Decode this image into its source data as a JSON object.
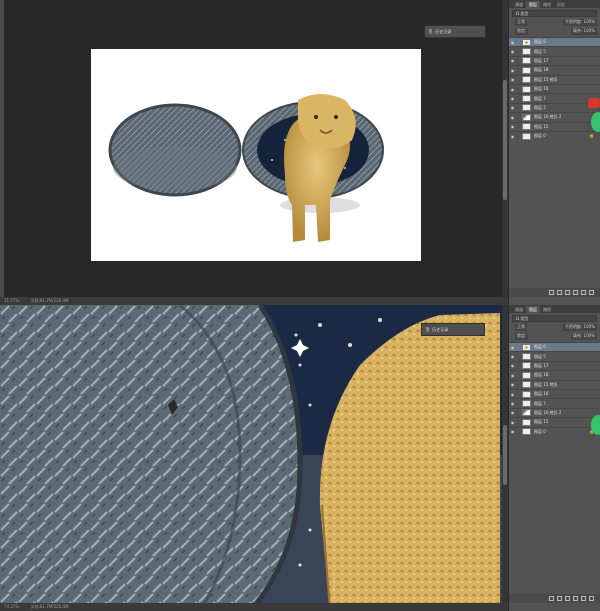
{
  "app": "Photoshop",
  "top_window": {
    "status": {
      "zoom": "11.57%",
      "doc_size": "文档:81.7M/226.4M"
    },
    "history_panel": {
      "label": "历史记录"
    },
    "layers_panel": {
      "tabs": [
        "通道",
        "图层",
        "路径",
        "历史"
      ],
      "filter_label": "Ω 类型",
      "blend_mode": "正常",
      "opacity": "不透明度: 100%",
      "lock_label": "锁定:",
      "fill": "填充: 100%",
      "layers": [
        {
          "name": "图层 6",
          "thumb": "tiger"
        },
        {
          "name": "图层 5",
          "thumb": "plain"
        },
        {
          "name": "图层 17",
          "thumb": "plain"
        },
        {
          "name": "图层 18",
          "thumb": "plain"
        },
        {
          "name": "图层 15 拷贝",
          "thumb": "plain"
        },
        {
          "name": "图层 16",
          "thumb": "plain"
        },
        {
          "name": "图层 7",
          "thumb": "plain"
        },
        {
          "name": "图层 2",
          "thumb": "plain"
        },
        {
          "name": "图层 16 拷贝 2",
          "thumb": "dark"
        },
        {
          "name": "图层 15",
          "thumb": "plain"
        },
        {
          "name": "图层 0",
          "thumb": "plain",
          "locked": true
        }
      ]
    }
  },
  "bottom_window": {
    "status": {
      "zoom": "74.37%",
      "doc_size": "文档:81.7M/226.4M"
    },
    "history_panel": {
      "label": "历史记录"
    },
    "layers_panel": {
      "tabs": [
        "通道",
        "图层",
        "路径"
      ],
      "filter_label": "Ω 类型",
      "blend_mode": "正常",
      "opacity": "不透明度: 100%",
      "lock_label": "锁定:",
      "fill": "填充: 100%",
      "layers": [
        {
          "name": "图层 6",
          "thumb": "tiger"
        },
        {
          "name": "图层 5",
          "thumb": "plain"
        },
        {
          "name": "图层 17",
          "thumb": "plain"
        },
        {
          "name": "图层 18",
          "thumb": "plain"
        },
        {
          "name": "图层 15 拷贝",
          "thumb": "plain"
        },
        {
          "name": "图层 16",
          "thumb": "plain"
        },
        {
          "name": "图层 7",
          "thumb": "plain"
        },
        {
          "name": "图层 16 拷贝 2",
          "thumb": "dark"
        },
        {
          "name": "图层 15",
          "thumb": "plain"
        },
        {
          "name": "图层 0",
          "thumb": "plain",
          "locked": true
        }
      ]
    }
  },
  "colors": {
    "panel": "#535353",
    "canvas_bg": "#282828",
    "selected_layer": "#6b7a8a",
    "accent_green": "#35c46b"
  }
}
